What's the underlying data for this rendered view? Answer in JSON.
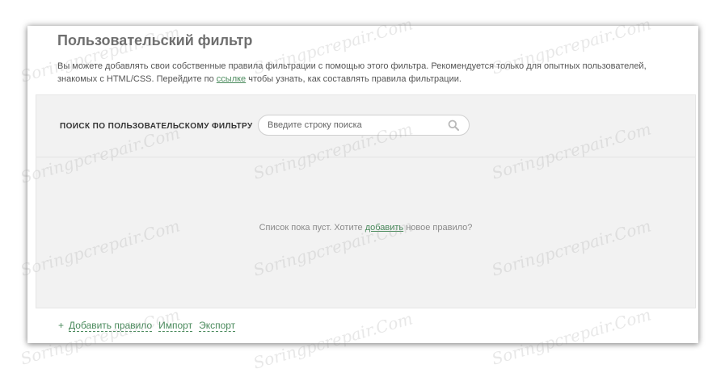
{
  "panel": {
    "title": "Пользовательский фильтр",
    "description": {
      "before_link": "Вы можете добавлять свои собственные правила фильтрации с помощью этого фильтра. Рекомендуется только для опытных пользователей, знакомых с HTML/CSS. Перейдите по ",
      "link": "ссылке",
      "after_link": " чтобы узнать, как составлять правила фильтрации."
    },
    "search": {
      "label": "ПОИСК ПО ПОЛЬЗОВАТЕЛЬСКОМУ ФИЛЬТРУ",
      "placeholder": "Введите строку поиска",
      "icon": "search-icon"
    },
    "empty_state": {
      "before_link": "Список пока пуст. Хотите ",
      "link": "добавить",
      "after_link": " новое правило?"
    },
    "footer": {
      "plus": "+",
      "add_rule": "Добавить правило",
      "import": "Импорт",
      "export": "Экспорт"
    }
  },
  "watermark": "Soringpcrepair.Com",
  "colors": {
    "link": "#4a8a5c",
    "panel_bg": "#f2f2f2",
    "title": "#6f6f6f"
  }
}
